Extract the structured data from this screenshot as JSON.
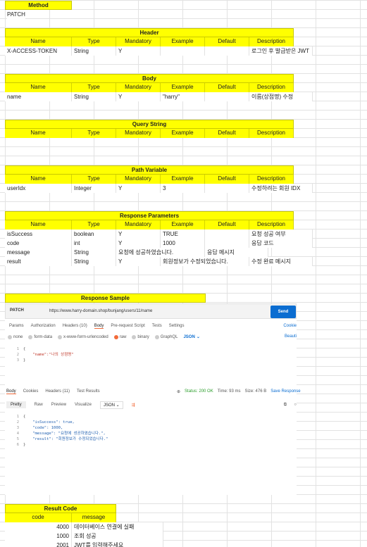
{
  "method_section": {
    "title": "Method",
    "value": "PATCH"
  },
  "header_section": {
    "title": "Header",
    "columns": [
      "Name",
      "Type",
      "Mandatory",
      "Example",
      "Default",
      "Description"
    ],
    "rows": [
      [
        "X-ACCESS-TOKEN",
        "String",
        "Y",
        "",
        "",
        "로그인 후 발급받은 JWT"
      ]
    ]
  },
  "body_section": {
    "title": "Body",
    "columns": [
      "Name",
      "Type",
      "Mandatory",
      "Example",
      "Default",
      "Description"
    ],
    "rows": [
      [
        "name",
        "String",
        "Y",
        "\"harry\"",
        "",
        "이름(상점명) 수정"
      ]
    ]
  },
  "query_section": {
    "title": "Query String",
    "columns": [
      "Name",
      "Type",
      "Mandatory",
      "Example",
      "Default",
      "Description"
    ]
  },
  "path_section": {
    "title": "Path Variable",
    "columns": [
      "Name",
      "Type",
      "Mandatory",
      "Example",
      "Default",
      "Description"
    ],
    "rows": [
      [
        "userIdx",
        "Integer",
        "Y",
        "3",
        "",
        "수정하려는 회원 IDX"
      ]
    ]
  },
  "response_section": {
    "title": "Response Parameters",
    "columns": [
      "Name",
      "Type",
      "Mandatory",
      "Example",
      "Default",
      "Description"
    ],
    "rows": [
      [
        "isSuccess",
        "boolean",
        "Y",
        "TRUE",
        "",
        "요청 성공 여부"
      ],
      [
        "code",
        "int",
        "Y",
        "1000",
        "",
        "응답 코드"
      ],
      [
        "message",
        "String",
        "Y",
        "요청에 성공하였습니다.",
        "",
        "응답 메시지"
      ],
      [
        "result",
        "String",
        "Y",
        "회원정보가 수정되었습니다.",
        "",
        "수정 완료 메시지"
      ]
    ]
  },
  "sample_section": {
    "title": "Response Sample"
  },
  "postman": {
    "method": "PATCH",
    "url": "https://www.harry-domain.shop/bunjang/users/11/name",
    "send": "Send",
    "req_tabs": [
      "Params",
      "Authorization",
      "Headers (10)",
      "Body",
      "Pre-request Script",
      "Tests",
      "Settings"
    ],
    "cookies": "Cookie",
    "radios": [
      "none",
      "form-data",
      "x-www-form-urlencoded",
      "raw",
      "binary",
      "GraphQL"
    ],
    "json_label": "JSON",
    "beautify": "Beauti",
    "req_lines": [
      "{",
      "    \"name\":\"나의 상점명\"",
      "}"
    ],
    "res_tabs": [
      "Body",
      "Cookies",
      "Headers (11)",
      "Test Results"
    ],
    "status": "Status: 200 OK",
    "time": "Time: 93 ms",
    "size": "Size: 476 B",
    "save": "Save Response",
    "view_tabs": [
      "Pretty",
      "Raw",
      "Preview",
      "Visualize"
    ],
    "view_json": "JSON",
    "res_lines": [
      "{",
      "    \"isSuccess\": true,",
      "    \"code\": 1000,",
      "    \"message\": \"요청에 성공하였습니다.\",",
      "    \"result\": \"회원정보가 수정되었습니다.\"",
      "}"
    ]
  },
  "result_code": {
    "title": "Result Code",
    "columns": [
      "code",
      "message"
    ],
    "rows": [
      [
        "4000",
        "데이터베이스 연결에 실패"
      ],
      [
        "1000",
        "조회 성공"
      ],
      [
        "2001",
        "JWT를 입력해주세요"
      ]
    ]
  }
}
